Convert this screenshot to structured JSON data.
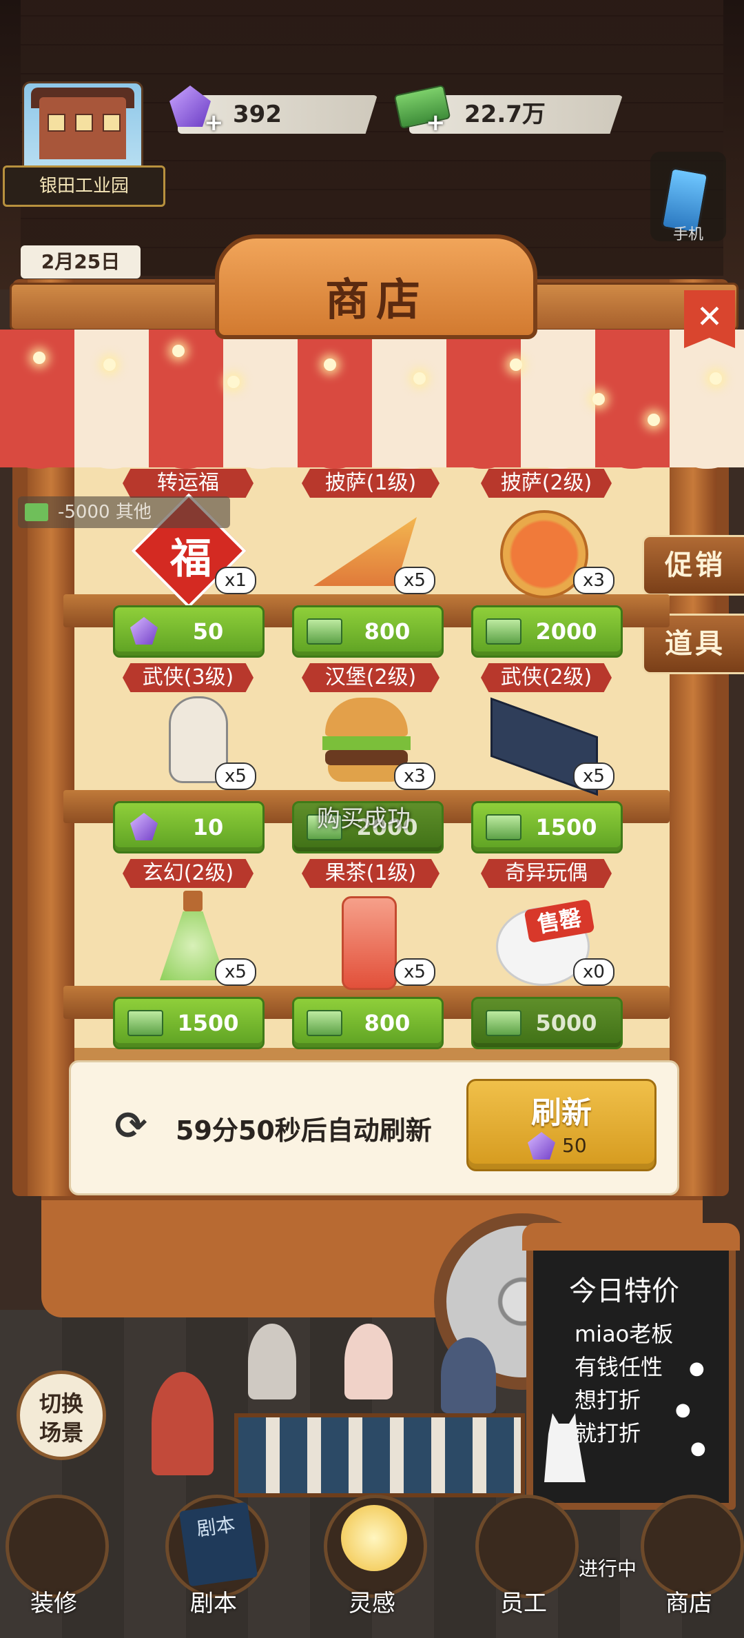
{
  "hud": {
    "location": "银田工业园",
    "gems": "392",
    "cash": "22.7万",
    "date": "2月25日",
    "phone_label": "手机",
    "plus": "+"
  },
  "shop": {
    "title": "商店",
    "close": "✕",
    "side_tabs": [
      "促销",
      "道具"
    ],
    "deduction": "-5000  其他",
    "toast": "购买成功",
    "items": [
      {
        "name": "转运福",
        "qty": "x1",
        "price": "50",
        "currency": "gem"
      },
      {
        "name": "披萨(1级)",
        "qty": "x5",
        "price": "800",
        "currency": "cash"
      },
      {
        "name": "披萨(2级)",
        "qty": "x3",
        "price": "2000",
        "currency": "cash"
      },
      {
        "name": "武侠(3级)",
        "qty": "x5",
        "price": "10",
        "currency": "gem"
      },
      {
        "name": "汉堡(2级)",
        "qty": "x3",
        "price": "2000",
        "currency": "cash"
      },
      {
        "name": "武侠(2级)",
        "qty": "x5",
        "price": "1500",
        "currency": "cash"
      },
      {
        "name": "玄幻(2级)",
        "qty": "x5",
        "price": "1500",
        "currency": "cash"
      },
      {
        "name": "果茶(1级)",
        "qty": "x5",
        "price": "800",
        "currency": "cash"
      },
      {
        "name": "奇异玩偶",
        "qty": "x0",
        "price": "5000",
        "currency": "cash",
        "sold_out": "售罄"
      }
    ],
    "fu_char": "福",
    "refresh": {
      "timer_text": "59分50秒后自动刷新",
      "button_label": "刷新",
      "cost": "50"
    }
  },
  "chalkboard": {
    "title": "今日特价",
    "lines": [
      "miao老板",
      "有钱任性",
      "想打折",
      "就打折"
    ]
  },
  "scene": {
    "switch_label_1": "切换",
    "switch_label_2": "场景",
    "ongoing": "进行中"
  },
  "nav": [
    "装修",
    "剧本",
    "灵感",
    "员工",
    "商店"
  ],
  "book_label": "剧本",
  "colors": {
    "price_green": "#6bb02a",
    "banner_red": "#b8382c",
    "refresh_gold": "#e3aa2e"
  }
}
